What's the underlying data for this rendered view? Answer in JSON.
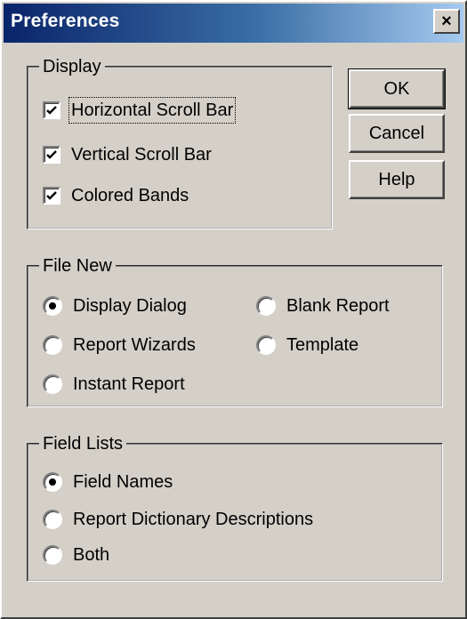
{
  "window": {
    "title": "Preferences",
    "close_glyph": "×"
  },
  "display_group": {
    "title": "Display",
    "options": [
      {
        "label": "Horizontal Scroll Bar",
        "checked": true
      },
      {
        "label": "Vertical Scroll Bar",
        "checked": true
      },
      {
        "label": "Colored Bands",
        "checked": true
      }
    ]
  },
  "buttons": {
    "ok": "OK",
    "cancel": "Cancel",
    "help": "Help"
  },
  "file_new_group": {
    "title": "File New",
    "options": [
      {
        "label": "Display Dialog",
        "selected": true
      },
      {
        "label": "Blank Report",
        "selected": false
      },
      {
        "label": "Report Wizards",
        "selected": false
      },
      {
        "label": "Template",
        "selected": false
      },
      {
        "label": "Instant Report",
        "selected": false
      }
    ]
  },
  "field_lists_group": {
    "title": "Field Lists",
    "options": [
      {
        "label": "Field Names",
        "selected": true
      },
      {
        "label": "Report Dictionary Descriptions",
        "selected": false
      },
      {
        "label": "Both",
        "selected": false
      }
    ]
  },
  "colors": {
    "face": "#d4d0c8",
    "title_start": "#0a246a",
    "title_end": "#a6caf0"
  }
}
